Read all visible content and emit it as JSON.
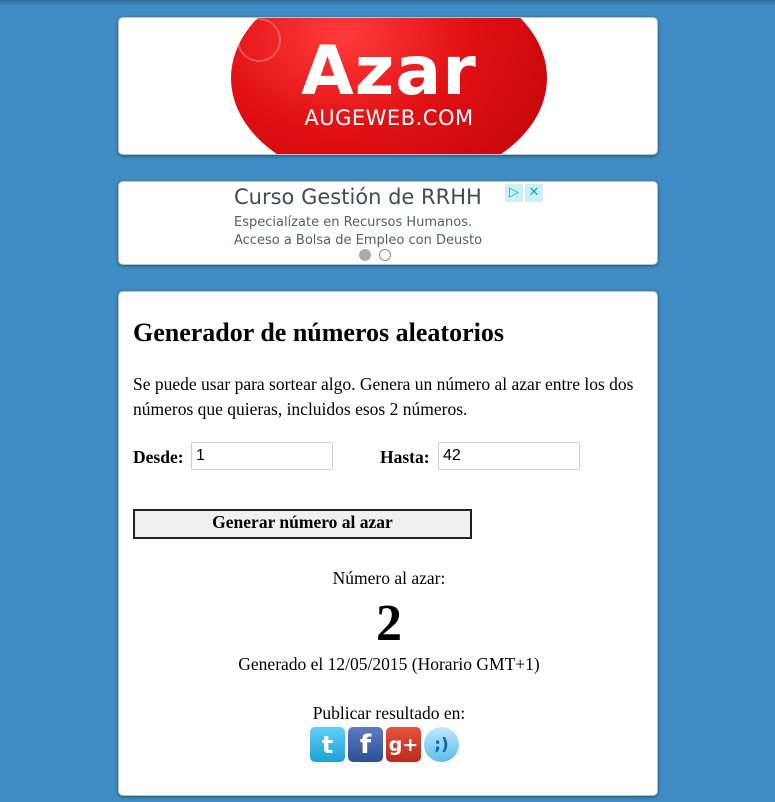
{
  "logo": {
    "word": "Azar",
    "subtitle": "AUGEWEB.COM",
    "color": "#e00f12"
  },
  "ad": {
    "title": "Curso Gestión de RRHH",
    "line1": "Especialízate en Recursos Humanos.",
    "line2": "Acceso a Bolsa de Empleo con Deusto",
    "adchoices_glyph": "▷",
    "close_glyph": "✕"
  },
  "generator": {
    "title": "Generador de números aleatorios",
    "description": "Se puede usar para sortear algo. Genera un número al azar entre los dos números que quieras, incluidos esos 2 números.",
    "from_label": "Desde:",
    "from_value": "1",
    "to_label": "Hasta:",
    "to_value": "42",
    "button_label": "Generar número al azar",
    "result_label": "Número al azar:",
    "result_value": "2",
    "generated_text": "Generado el 12/05/2015 (Horario GMT+1)",
    "publish_label": "Publicar resultado en:"
  },
  "social": [
    {
      "name": "twitter-icon",
      "glyph": "t"
    },
    {
      "name": "facebook-icon",
      "glyph": "f"
    },
    {
      "name": "google-plus-icon",
      "glyph": "g+"
    },
    {
      "name": "tuenti-icon",
      "glyph": ";)"
    }
  ],
  "colors": {
    "page_background": "#3f8dc2",
    "panel_background": "#ffffff"
  }
}
